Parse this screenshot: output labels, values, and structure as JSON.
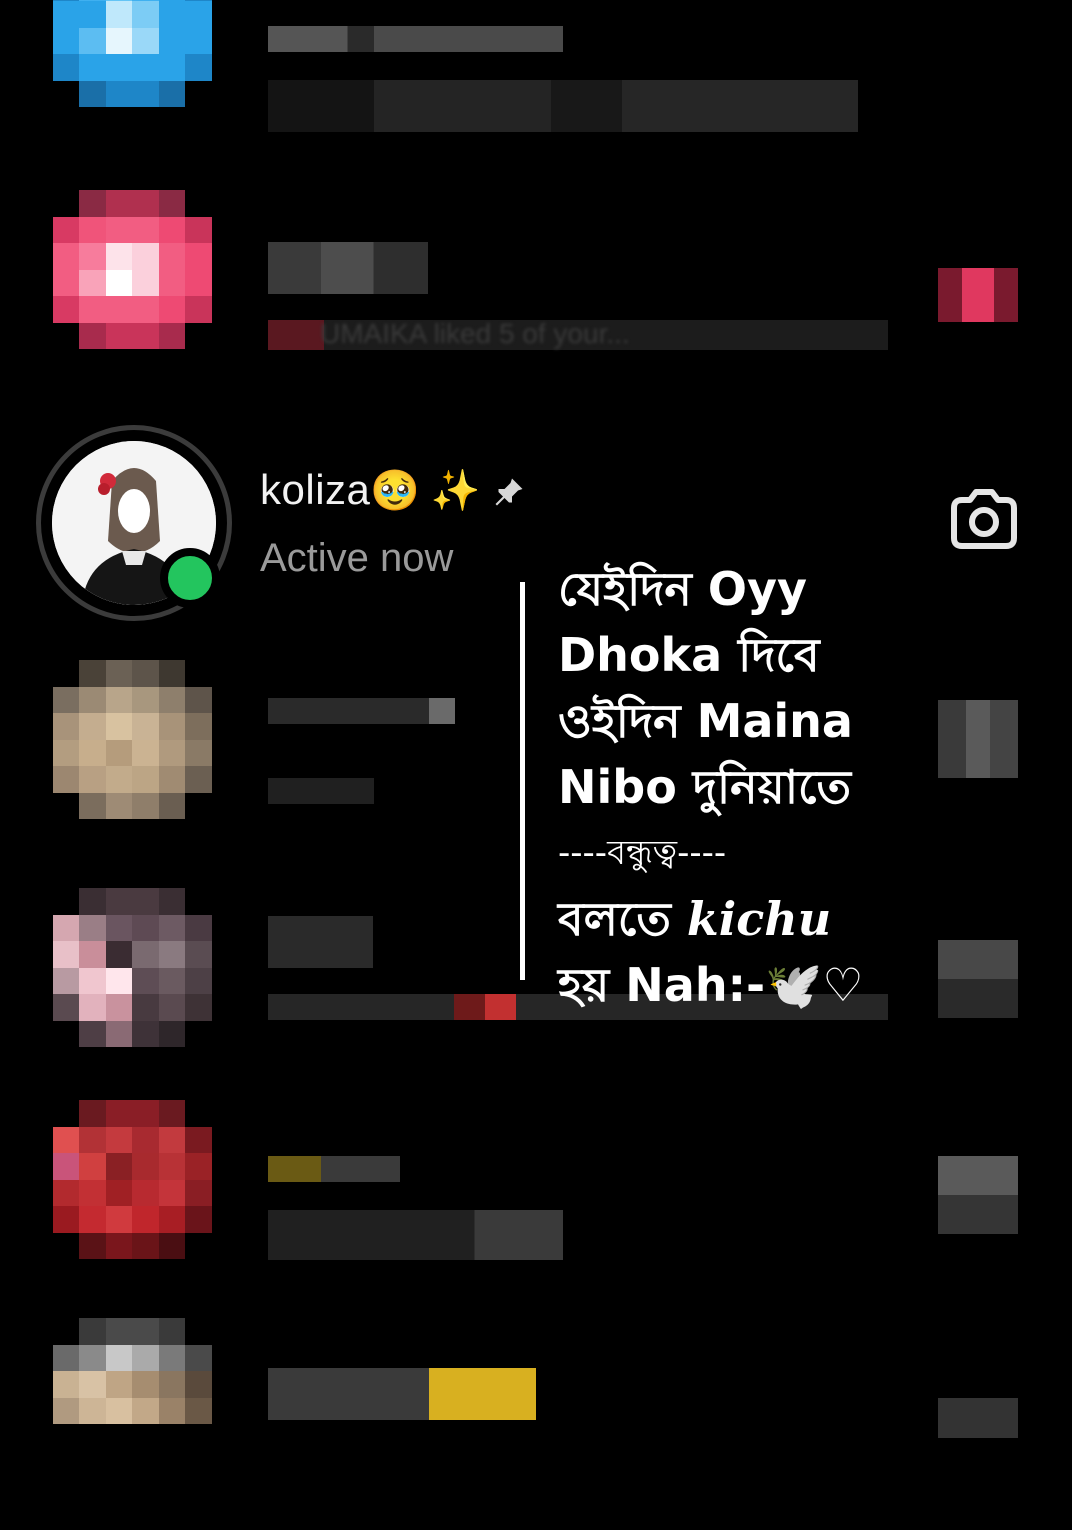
{
  "chat": {
    "name": "koliza",
    "name_emoji": "🥹",
    "sparkle_emoji": "✨",
    "pin_icon": "pin-icon",
    "status": "Active now",
    "camera_icon": "camera-icon",
    "online_color": "#23c55e"
  },
  "overlay_text": {
    "line1": "যেইদিন Oyy",
    "line2": "Dhoka দিবে",
    "line3": "ওইদিন Maina",
    "line4": "Nibo দুনিয়াতে",
    "line5": "----বন্ধুত্ব----",
    "line6_a": "বলতে ",
    "line6_b": "kichu",
    "line7": "হয় Nah:-🕊️♡"
  },
  "blurred_text": "UMAIKA liked 5 of your..."
}
